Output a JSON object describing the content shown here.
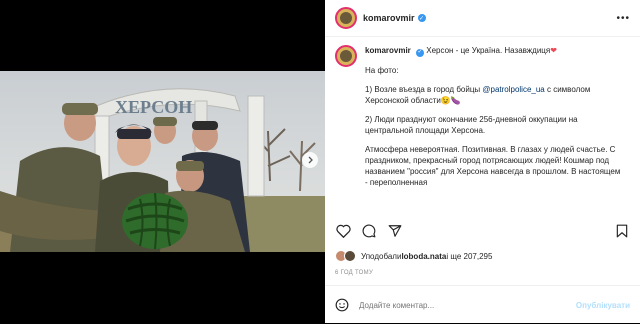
{
  "post": {
    "username": "komarovmir",
    "caption_title": "Херсон - це Україна. Назавждиця",
    "caption_paragraphs": [
      {
        "text": "На фото:"
      },
      {
        "pre": "1) Возле въезда в город бойцы ",
        "mention": "@patrolpolice_ua",
        "post": " с символом Херсонской области😉🍆"
      },
      {
        "text": "2) Люди празднуют окончание 256-дневной оккупации на центральной площади Херсона."
      },
      {
        "text": "Атмосфера невероятная. Позитивная. В глазах у людей счастье. С праздником, прекрасный город потрясающих людей! Кошмар под названием \"россия\" для Херсона навсегда в прошлом.  В настоящем - переполненная"
      }
    ],
    "photo_sign": "ХЕРСОН"
  },
  "likes": {
    "prefix": "Уподобали ",
    "user": "loboda.nata",
    "suffix": " і ще 207,295"
  },
  "timestamp": "6 ГОД ТОМУ",
  "comment": {
    "placeholder": "Додайте коментар...",
    "publish_label": "Опублікувати"
  },
  "icons": {
    "more": "more-icon",
    "like": "heart-icon",
    "comment": "comment-icon",
    "share": "share-icon",
    "save": "bookmark-icon",
    "emoji": "emoji-icon",
    "next": "chevron-right-icon"
  },
  "colors": {
    "verified": "#3897f0",
    "link": "#00376b",
    "publish_disabled": "#b2dffc",
    "meta": "#8e8e8e"
  }
}
